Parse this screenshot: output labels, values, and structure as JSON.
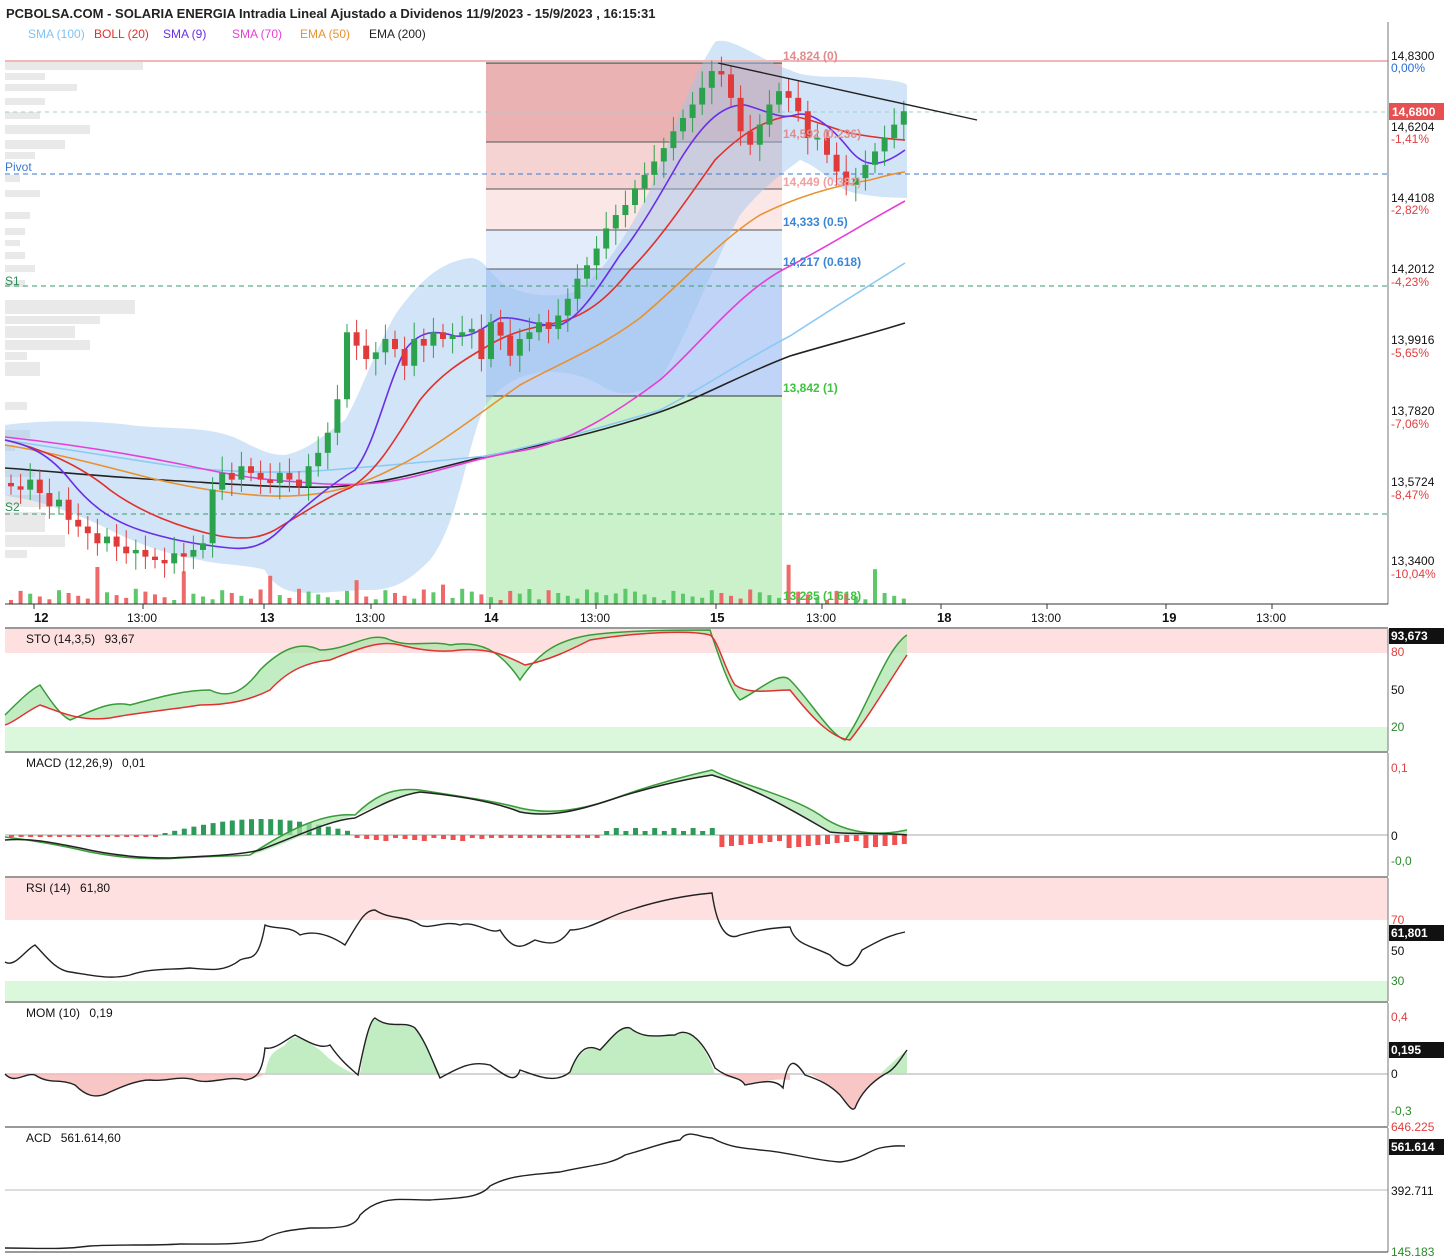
{
  "title": "PCBOLSA.COM - SOLARIA ENERGIA Intradia Lineal Ajustado a Dividenos 11/9/2023 - 15/9/2023 , 16:15:31",
  "legend": [
    {
      "label": "SMA (100)",
      "color": "#7fc3f0"
    },
    {
      "label": "BOLL (20)",
      "color": "#e0302a"
    },
    {
      "label": "SMA (9)",
      "color": "#6a2ee8"
    },
    {
      "label": "SMA (70)",
      "color": "#e63fd8"
    },
    {
      "label": "EMA (50)",
      "color": "#e8912e"
    },
    {
      "label": "EMA (200)",
      "color": "#222222"
    }
  ],
  "pivot_labels": {
    "pivot": "Pivot",
    "s1": "S1",
    "s2": "S2"
  },
  "fib_labels": [
    {
      "text": "14,824 (0)",
      "value": 14.824,
      "color": "#e08c8c"
    },
    {
      "text": "14,592 (0.236)",
      "value": 14.592,
      "color": "#e08c8c"
    },
    {
      "text": "14,449 (0.382)",
      "value": 14.449,
      "color": "#f0a0a0"
    },
    {
      "text": "14,333 (0.5)",
      "value": 14.333,
      "color": "#3a86d6"
    },
    {
      "text": "14,217 (0.618)",
      "value": 14.217,
      "color": "#3a86d6"
    },
    {
      "text": "13,842 (1)",
      "value": 13.842,
      "color": "#3ec43e"
    },
    {
      "text": "13,235 (1.618)",
      "value": 13.235,
      "color": "#3ec43e"
    }
  ],
  "price_axis": [
    {
      "label": "14,8300",
      "pct": "0,00%",
      "value": 14.83
    },
    {
      "label": "14,6204",
      "pct": "-1,41%",
      "value": 14.6204
    },
    {
      "label": "14,4108",
      "pct": "-2,82%",
      "value": 14.4108
    },
    {
      "label": "14,2012",
      "pct": "-4,23%",
      "value": 14.2012
    },
    {
      "label": "13,9916",
      "pct": "-5,65%",
      "value": 13.9916
    },
    {
      "label": "13,7820",
      "pct": "-7,06%",
      "value": 13.782
    },
    {
      "label": "13,5724",
      "pct": "-8,47%",
      "value": 13.5724
    },
    {
      "label": "13,3400",
      "pct": "-10,04%",
      "value": 13.34
    }
  ],
  "last_price": "14,6800",
  "x_axis": [
    {
      "label": "12",
      "bold": true
    },
    {
      "label": "13:00",
      "bold": false
    },
    {
      "label": "13",
      "bold": true
    },
    {
      "label": "13:00",
      "bold": false
    },
    {
      "label": "14",
      "bold": true
    },
    {
      "label": "13:00",
      "bold": false
    },
    {
      "label": "15",
      "bold": true
    },
    {
      "label": "13:00",
      "bold": false
    },
    {
      "label": "18",
      "bold": true
    },
    {
      "label": "13:00",
      "bold": false
    },
    {
      "label": "19",
      "bold": true
    },
    {
      "label": "13:00",
      "bold": false
    }
  ],
  "sto": {
    "title": "STO (14,3,5)",
    "value": "93,67",
    "last": "93,673",
    "levels": [
      "80",
      "50",
      "20"
    ]
  },
  "macd": {
    "title": "MACD (12,26,9)",
    "value": "0,01",
    "levels": [
      "0,1",
      "0",
      "-0,0"
    ]
  },
  "rsi": {
    "title": "RSI (14)",
    "value": "61,80",
    "last": "61,801",
    "levels": [
      "70",
      "50",
      "30"
    ]
  },
  "mom": {
    "title": "MOM (10)",
    "value": "0,19",
    "last": "0,195",
    "levels": [
      "0,4",
      "0",
      "-0,3"
    ]
  },
  "acd": {
    "title": "ACD",
    "value": "561.614,60",
    "last": "561.614",
    "levels": [
      "646.225",
      "392.711",
      "145.183"
    ]
  },
  "chart_data": {
    "type": "candlestick",
    "y_range": [
      13.34,
      14.83
    ],
    "close_series": [
      13.56,
      13.55,
      13.58,
      13.54,
      13.5,
      13.52,
      13.46,
      13.44,
      13.42,
      13.39,
      13.41,
      13.38,
      13.36,
      13.37,
      13.35,
      13.34,
      13.33,
      13.36,
      13.35,
      13.37,
      13.39,
      13.55,
      13.6,
      13.58,
      13.62,
      13.6,
      13.58,
      13.57,
      13.6,
      13.58,
      13.56,
      13.62,
      13.66,
      13.72,
      13.82,
      14.02,
      13.98,
      13.94,
      13.96,
      14.0,
      13.97,
      13.92,
      14.0,
      13.98,
      14.02,
      14.0,
      14.01,
      14.02,
      14.03,
      13.94,
      14.05,
      14.01,
      13.95,
      14.0,
      14.02,
      14.05,
      14.03,
      14.07,
      14.12,
      14.18,
      14.22,
      14.27,
      14.33,
      14.37,
      14.4,
      14.45,
      14.49,
      14.53,
      14.57,
      14.62,
      14.66,
      14.7,
      14.75,
      14.8,
      14.79,
      14.72,
      14.62,
      14.58,
      14.64,
      14.7,
      14.74,
      14.72,
      14.68,
      14.6,
      14.6,
      14.55,
      14.5,
      14.46,
      14.48,
      14.52,
      14.56,
      14.6,
      14.64,
      14.68
    ]
  }
}
